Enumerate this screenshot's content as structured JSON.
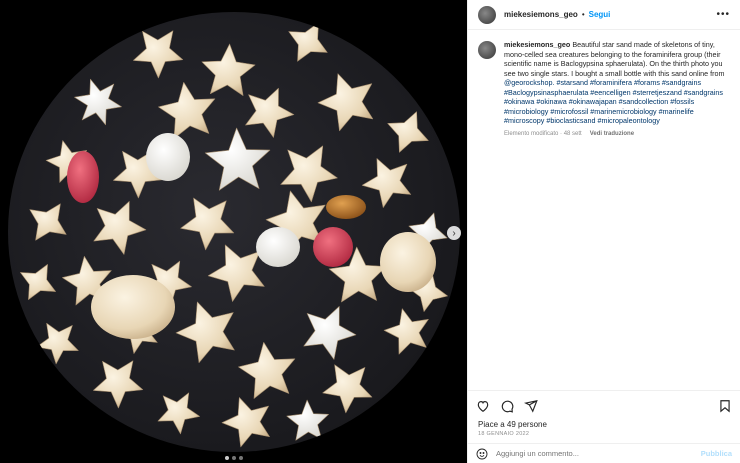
{
  "header": {
    "username": "miekesiemons_geo",
    "separator": "•",
    "follow_label": "Segui",
    "more_icon": "more-horizontal-icon"
  },
  "caption": {
    "username": "miekesiemons_geo",
    "text": "Beautiful star sand made of skeletons of tiny, mono-celled sea creatures belonging to the foraminifera group (their scientific name is Baclogypsina sphaerulata). On the thirth photo you see two single stars. I bought a small bottle with this sand online from ",
    "mention": "@georockshop",
    "hashtags": ". #starsand #foraminifera #forams #sandgrains #Baclogypsinasphaerulata #eencelligen #sterretjeszand #sandgrains #okinawa #okinawa #okinawajapan #sandcollection #fossils #microbiology #microfossil #marinemicrobiology #marinelife #microscopy #bioclasticsand #micropaleontology",
    "edited": "Elemento modificato · 48 sett",
    "translate": "Vedi traduzione"
  },
  "actions": {
    "like_icon": "heart-icon",
    "comment_icon": "comment-icon",
    "share_icon": "send-icon",
    "save_icon": "bookmark-icon"
  },
  "likes": "Piace a 49 persone",
  "date": "18 GENNAIO 2022",
  "comment_box": {
    "placeholder": "Aggiungi un commento...",
    "publish": "Pubblica",
    "emoji_icon": "emoji-icon"
  },
  "media": {
    "next_icon": "chevron-right-icon",
    "carousel_count": 3,
    "carousel_active": 1
  }
}
